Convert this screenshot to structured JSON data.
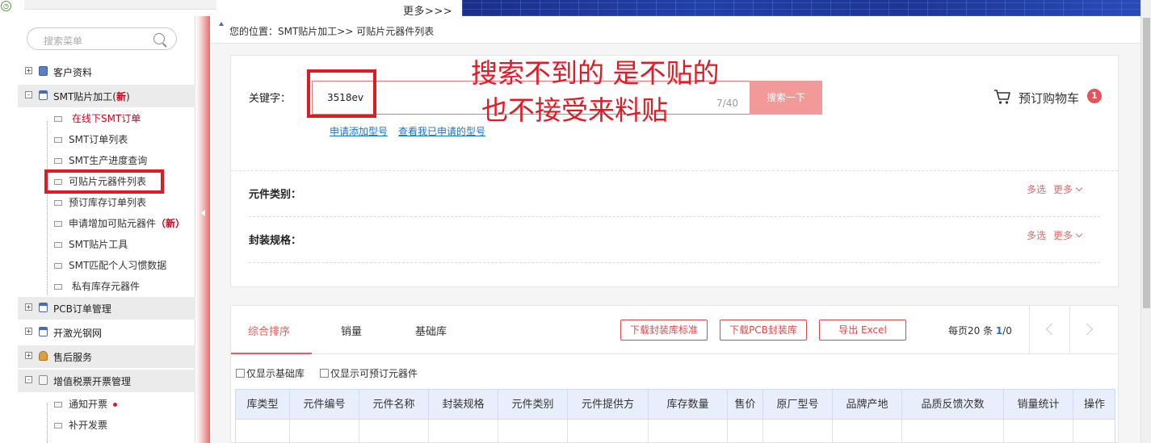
{
  "top": {
    "more_link": "更多>>>"
  },
  "sidebar": {
    "search_placeholder": "搜索菜单",
    "groups": [
      {
        "label": "客户资料",
        "toggle": "+"
      },
      {
        "label": "SMT贴片加工(",
        "new": "新",
        "close": ")",
        "toggle": "-"
      },
      {
        "label": "PCB订单管理",
        "toggle": "+"
      },
      {
        "label": "开激光钢网",
        "toggle": "+"
      },
      {
        "label": "售后服务",
        "toggle": "+"
      },
      {
        "label": "增值税票开票管理",
        "toggle": "-"
      }
    ],
    "items": [
      {
        "label": "在线下SMT订单"
      },
      {
        "label": "SMT订单列表"
      },
      {
        "label": "SMT生产进度查询"
      },
      {
        "label": "可贴片元器件列表"
      },
      {
        "label": "预订库存订单列表"
      },
      {
        "label": "申请增加可贴元器件",
        "badge": "（新）"
      },
      {
        "label": "SMT贴片工具"
      },
      {
        "label": "SMT匹配个人习惯数据"
      },
      {
        "label": "私有库存元器件"
      }
    ],
    "invoice_items": [
      {
        "label": "通知开票"
      },
      {
        "label": "补开发票"
      }
    ]
  },
  "breadcrumb": {
    "label": "您的位置：",
    "value": "SMT贴片加工>> 可贴片元器件列表"
  },
  "search": {
    "keyword_label": "关键字：",
    "value": "3518ev",
    "counter": "7/40",
    "button": "搜索一下",
    "link_add": "申请添加型号",
    "link_view": "查看我已申请的型号"
  },
  "annotation": {
    "line1": "搜索不到的  是不贴的",
    "line2": "也不接受来料贴"
  },
  "cart": {
    "label": "预订购物车",
    "count": "1"
  },
  "filters": [
    {
      "label": "元件类别：",
      "multi": "多选",
      "more": "更多"
    },
    {
      "label": "封装规格：",
      "multi": "多选",
      "more": "更多"
    }
  ],
  "tabs": [
    {
      "label": "综合排序"
    },
    {
      "label": "销量"
    },
    {
      "label": "基础库"
    }
  ],
  "actions": {
    "download_std": "下载封装库标准",
    "download_pcb": "下载PCB封装库",
    "export": "导出 Excel"
  },
  "pagination": {
    "per_page_prefix": "每页20  条  ",
    "current": "1",
    "total": "/0"
  },
  "checkboxes": [
    {
      "label": "仅显示基础库"
    },
    {
      "label": "仅显示可预订元器件"
    }
  ],
  "table": {
    "headers": [
      "库类型",
      "元件编号",
      "元件名称",
      "封装规格",
      "元件类别",
      "元件提供方",
      "库存数量",
      "售价",
      "原厂型号",
      "品牌产地",
      "品质反馈次数",
      "销量统计",
      "操作"
    ]
  },
  "colors": {
    "accent": "#e85b5b",
    "link": "#1a73c8",
    "annotation": "#e01b24",
    "header_bg": "#e8eefc"
  }
}
